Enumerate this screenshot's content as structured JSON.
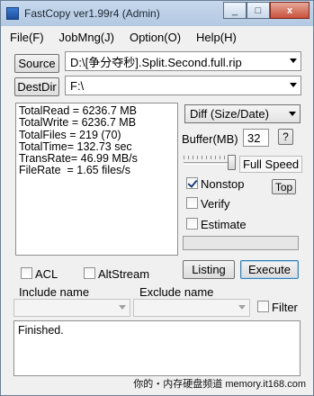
{
  "window": {
    "title": "FastCopy ver1.99r4 (Admin)",
    "caption": {
      "minimize": "_",
      "maximize": "□",
      "close": "x"
    }
  },
  "menu": [
    "File(F)",
    "JobMng(J)",
    "Option(O)",
    "Help(H)"
  ],
  "source": {
    "button": "Source",
    "value": "D:\\[争分夺秒].Split.Second.full.rip"
  },
  "destdir": {
    "button": "DestDir",
    "value": "F:\\"
  },
  "stats": {
    "total_read": "TotalRead = 6236.7 MB",
    "total_write": "TotalWrite = 6236.7 MB",
    "total_files": "TotalFiles = 219 (70)",
    "total_time": "TotalTime= 132.73 sec",
    "trans_rate": "TransRate= 46.99 MB/s",
    "file_rate": "FileRate  = 1.65 files/s"
  },
  "mode": {
    "value": "Diff (Size/Date)"
  },
  "buffer": {
    "label": "Buffer(MB)",
    "value": "32",
    "help": "?"
  },
  "speed": {
    "label": "Full Speed",
    "level": 1.0
  },
  "options": {
    "nonstop": {
      "label": "Nonstop",
      "checked": true
    },
    "verify": {
      "label": "Verify",
      "checked": false
    },
    "estimate": {
      "label": "Estimate",
      "checked": false
    },
    "top": "Top"
  },
  "buttons": {
    "listing": "Listing",
    "execute": "Execute"
  },
  "filters": {
    "acl": {
      "label": "ACL",
      "checked": false
    },
    "altstream": {
      "label": "AltStream",
      "checked": false
    },
    "include_label": "Include name",
    "exclude_label": "Exclude name",
    "filter": {
      "label": "Filter",
      "checked": false
    }
  },
  "log": {
    "text": "Finished."
  },
  "watermark": "你的・内存硬盘频道  memory.it168.com"
}
